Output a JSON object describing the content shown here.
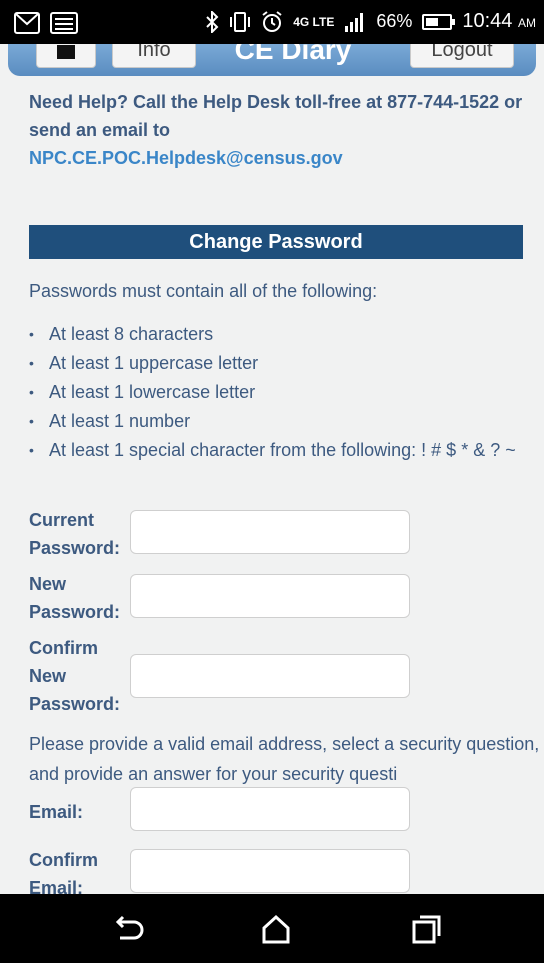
{
  "status_bar": {
    "battery": "66%",
    "time": "10:44",
    "ampm": "AM",
    "network": "4G LTE"
  },
  "header": {
    "title": "CE Diary",
    "info_label": "Info",
    "logout_label": "Logout"
  },
  "help": {
    "text": "Need Help? Call the Help Desk toll-free at 877-744-1522 or send an email to",
    "email": "NPC.CE.POC.Helpdesk@census.gov"
  },
  "change_password": {
    "title": "Change Password",
    "intro": "Passwords must contain all of the following:",
    "rules": [
      "At least 8 characters",
      "At least 1 uppercase letter",
      "At least 1 lowercase letter",
      "At least 1 number",
      "At least 1 special character from the following: ! # $ * & ? ~"
    ]
  },
  "fields": {
    "current_password": {
      "label_1": "Current",
      "label_2": "Password:",
      "value": ""
    },
    "new_password": {
      "label_1": "New",
      "label_2": "Password:",
      "value": ""
    },
    "confirm_password": {
      "label_1": "Confirm",
      "label_2": "New",
      "label_3": "Password:",
      "value": ""
    },
    "email_intro": "Please provide a valid email address, select a security question, and provide an answer for your security questi",
    "email": {
      "label": "Email:",
      "value": ""
    },
    "confirm_email": {
      "label_1": "Confirm",
      "label_2": "Email:",
      "value": ""
    }
  },
  "icons": {
    "mail": "mail-icon",
    "bluetooth": "bluetooth-icon",
    "vibrate": "vibrate-icon",
    "alarm": "alarm-icon",
    "signal": "signal-icon",
    "battery": "battery-icon",
    "home_header": "home-icon",
    "nav_back": "back-icon",
    "nav_home": "home-nav-icon",
    "nav_recent": "recent-apps-icon"
  },
  "colors": {
    "header_blue": "#5a8cc0",
    "section_bar": "#1f4f7c",
    "text": "#3d5a80",
    "link": "#3a86c8"
  }
}
